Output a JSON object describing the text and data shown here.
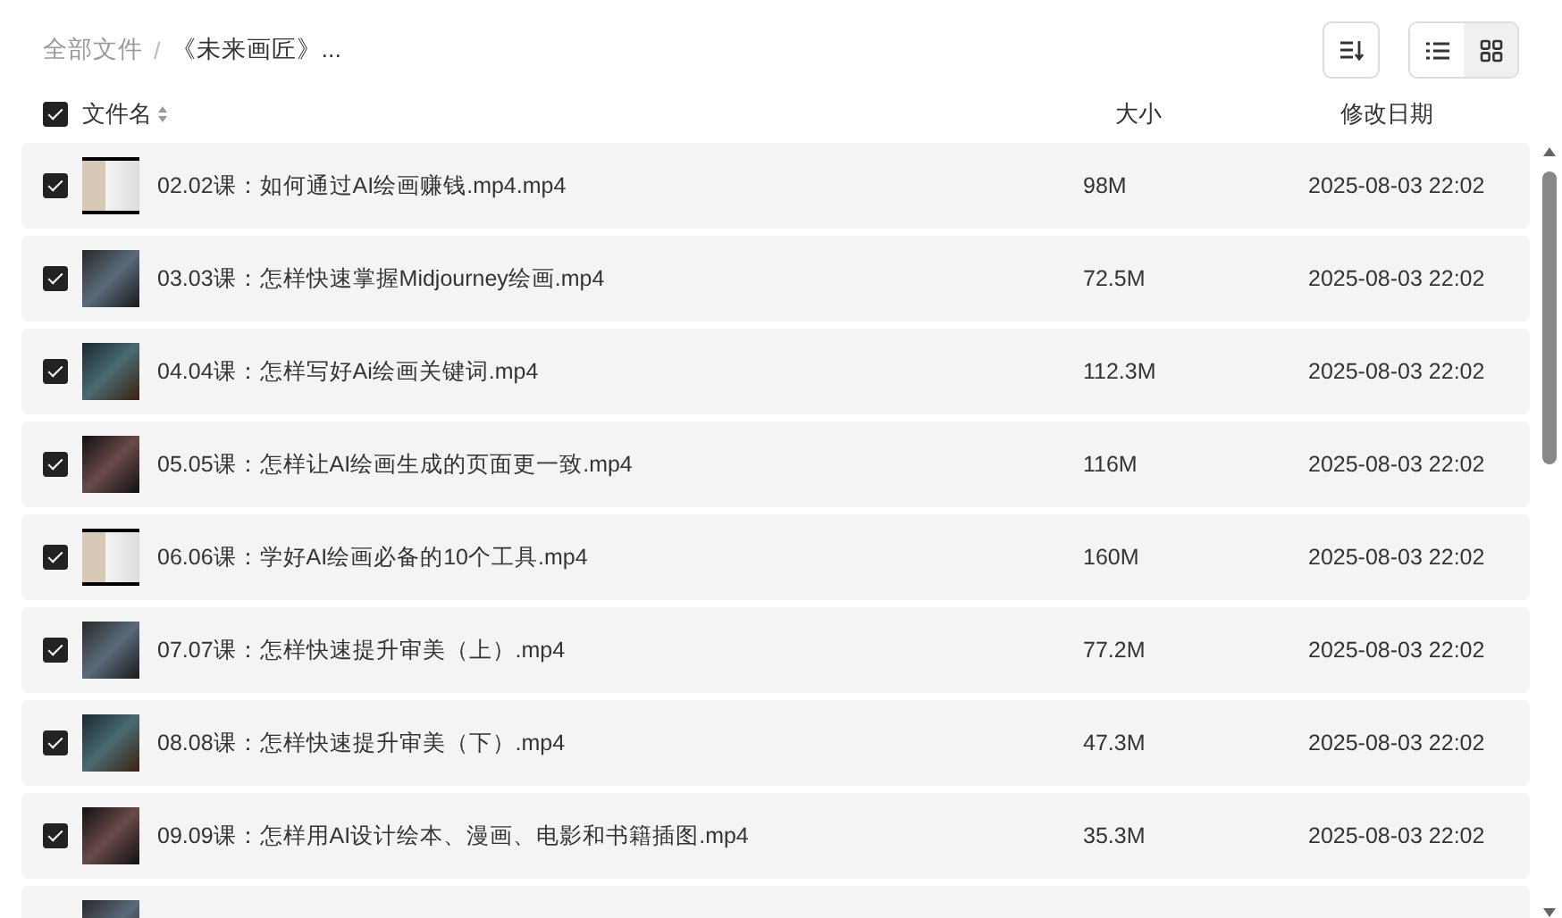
{
  "breadcrumb_separator": "/",
  "breadcrumb": [
    {
      "label": "全部文件",
      "current": false
    },
    {
      "label": "《未来画匠》...",
      "current": true
    }
  ],
  "view_toggle": [
    {
      "kind": "list",
      "selected": false
    },
    {
      "kind": "grid",
      "selected": true
    }
  ],
  "header": {
    "checked": true,
    "name": "文件名",
    "size": "大小",
    "date": "修改日期"
  },
  "files": [
    {
      "name": "02.02课：如何通过AI绘画赚钱.mp4.mp4",
      "size": "98M",
      "date": "2025-08-03 22:02",
      "checked": true
    },
    {
      "name": "03.03课：怎样快速掌握Midjourney绘画.mp4",
      "size": "72.5M",
      "date": "2025-08-03 22:02",
      "checked": true
    },
    {
      "name": "04.04课：怎样写好Ai绘画关键词.mp4",
      "size": "112.3M",
      "date": "2025-08-03 22:02",
      "checked": true
    },
    {
      "name": "05.05课：怎样让AI绘画生成的页面更一致.mp4",
      "size": "116M",
      "date": "2025-08-03 22:02",
      "checked": true
    },
    {
      "name": "06.06课：学好AI绘画必备的10个工具.mp4",
      "size": "160M",
      "date": "2025-08-03 22:02",
      "checked": true
    },
    {
      "name": "07.07课：怎样快速提升审美（上）.mp4",
      "size": "77.2M",
      "date": "2025-08-03 22:02",
      "checked": true
    },
    {
      "name": "08.08课：怎样快速提升审美（下）.mp4",
      "size": "47.3M",
      "date": "2025-08-03 22:02",
      "checked": true
    },
    {
      "name": "09.09课：怎样用AI设计绘本、漫画、电影和书籍插图.mp4",
      "size": "35.3M",
      "date": "2025-08-03 22:02",
      "checked": true
    }
  ]
}
